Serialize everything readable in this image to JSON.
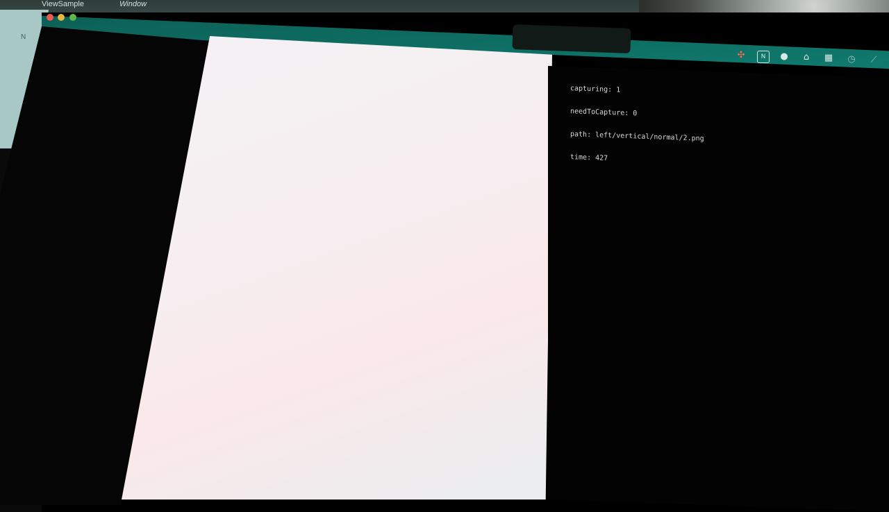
{
  "menubar": {
    "app_name": "ViewSample",
    "window_menu": "Window"
  },
  "left_window_tab": "N",
  "toolbar_icons": [
    "figma-icon",
    "notion-icon",
    "wechat-icon",
    "cloud-icon",
    "grid-icon",
    "clock-icon",
    "slash-icon"
  ],
  "console": {
    "lines": [
      "capturing: 1",
      "needToCapture: 0",
      "path: left/vertical/normal/2.png",
      "time: 427"
    ]
  },
  "colors": {
    "titlebar": "#0e6e63",
    "content_bg": "#f4f1f4",
    "console_bg": "#030303",
    "console_text": "#d9d9d9"
  }
}
